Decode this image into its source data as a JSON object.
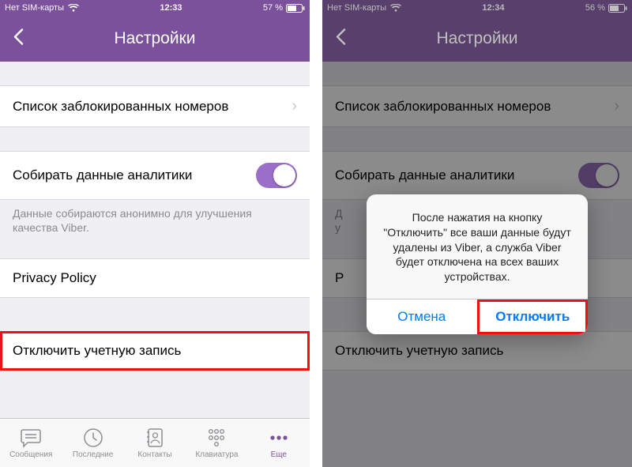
{
  "left": {
    "status": {
      "carrier": "Нет SIM-карты",
      "time": "12:33",
      "battery": "57 %"
    },
    "nav": {
      "title": "Настройки"
    },
    "rows": {
      "blocked": "Список заблокированных номеров",
      "analytics": "Собирать данные аналитики",
      "analytics_footer": "Данные собираются анонимно для улучшения качества Viber.",
      "privacy": "Privacy Policy",
      "deactivate": "Отключить учетную запись"
    },
    "tabs": {
      "messages": "Сообщения",
      "recent": "Последние",
      "contacts": "Контакты",
      "keypad": "Клавиатура",
      "more": "Еще"
    }
  },
  "right": {
    "status": {
      "carrier": "Нет SIM-карты",
      "time": "12:34",
      "battery": "56 %"
    },
    "nav": {
      "title": "Настройки"
    },
    "rows": {
      "blocked": "Список заблокированных номеров",
      "analytics": "Собирать данные аналитики",
      "analytics_footer_l1": "Д",
      "analytics_footer_l2": "у",
      "privacy_initial": "P",
      "deactivate": "Отключить учетную запись"
    },
    "alert": {
      "text": "После нажатия на кнопку \"Отключить\" все ваши данные будут удалены из Viber, а служба Viber будет отключена на всех ваших устройствах.",
      "cancel": "Отмена",
      "confirm": "Отключить"
    }
  }
}
